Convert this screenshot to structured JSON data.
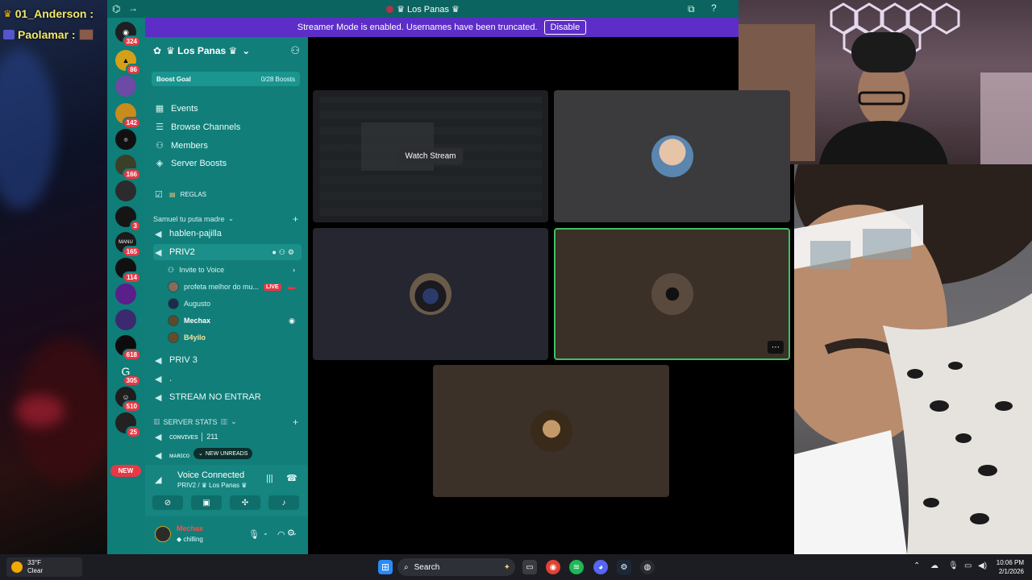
{
  "overlay_chat": [
    {
      "user": "01_Anderson :"
    },
    {
      "user": "Paolamar :"
    }
  ],
  "window": {
    "title": "Los Panas",
    "crown_glyph": "♛"
  },
  "streamer_banner": {
    "text": "Streamer Mode is enabled. Usernames have been truncated.",
    "button": "Disable"
  },
  "server_rail": {
    "badges": [
      "324",
      "86",
      "",
      "142",
      "",
      "166",
      "",
      "3",
      "165",
      "114",
      "",
      "",
      "618",
      "305",
      "510",
      "25"
    ],
    "new_label": "NEW"
  },
  "server": {
    "name": "♛ Los Panas ♛",
    "boost_label": "Boost Goal",
    "boost_progress": "0/28 Boosts",
    "nav": [
      "Events",
      "Browse Channels",
      "Members",
      "Server Boosts"
    ],
    "rules_channel": "REGLAS",
    "category_1": "Samuel tu puta madre",
    "channels_1": [
      "hablen-pajilla",
      "PRIV2"
    ],
    "invite_to_voice": "Invite to Voice",
    "members": [
      {
        "name": "profeta melhor do mu...",
        "live": "LIVE"
      },
      {
        "name": "Augusto"
      },
      {
        "name": "Mechax"
      },
      {
        "name": "B4yilo"
      }
    ],
    "channels_2": [
      "PRIV 3",
      ".",
      "STREAM NO ENTRAR"
    ],
    "category_2": "SERVER STATS",
    "stat_channels": [
      "ᴄᴏɴᴠɪᴠᴇs │ 211",
      "ᴍᴀʀɪᴄᴏ"
    ],
    "new_unreads": "NEW UNREADS"
  },
  "voice": {
    "status": "Voice Connected",
    "location": "PRIV2 / ♛ Los Panas ♛"
  },
  "user": {
    "name": "Mechax",
    "status": "chilling"
  },
  "stage": {
    "watch_label": "Watch Stream",
    "tile_more": "⋯"
  },
  "taskbar": {
    "weather_temp": "33°F",
    "weather_desc": "Clear",
    "search": "Search",
    "time": "10:06 PM",
    "date": "2/1/2026"
  },
  "colors": {
    "teal": "#127e79",
    "streamer_purple": "#5c2ec7",
    "live_red": "#e53945"
  }
}
